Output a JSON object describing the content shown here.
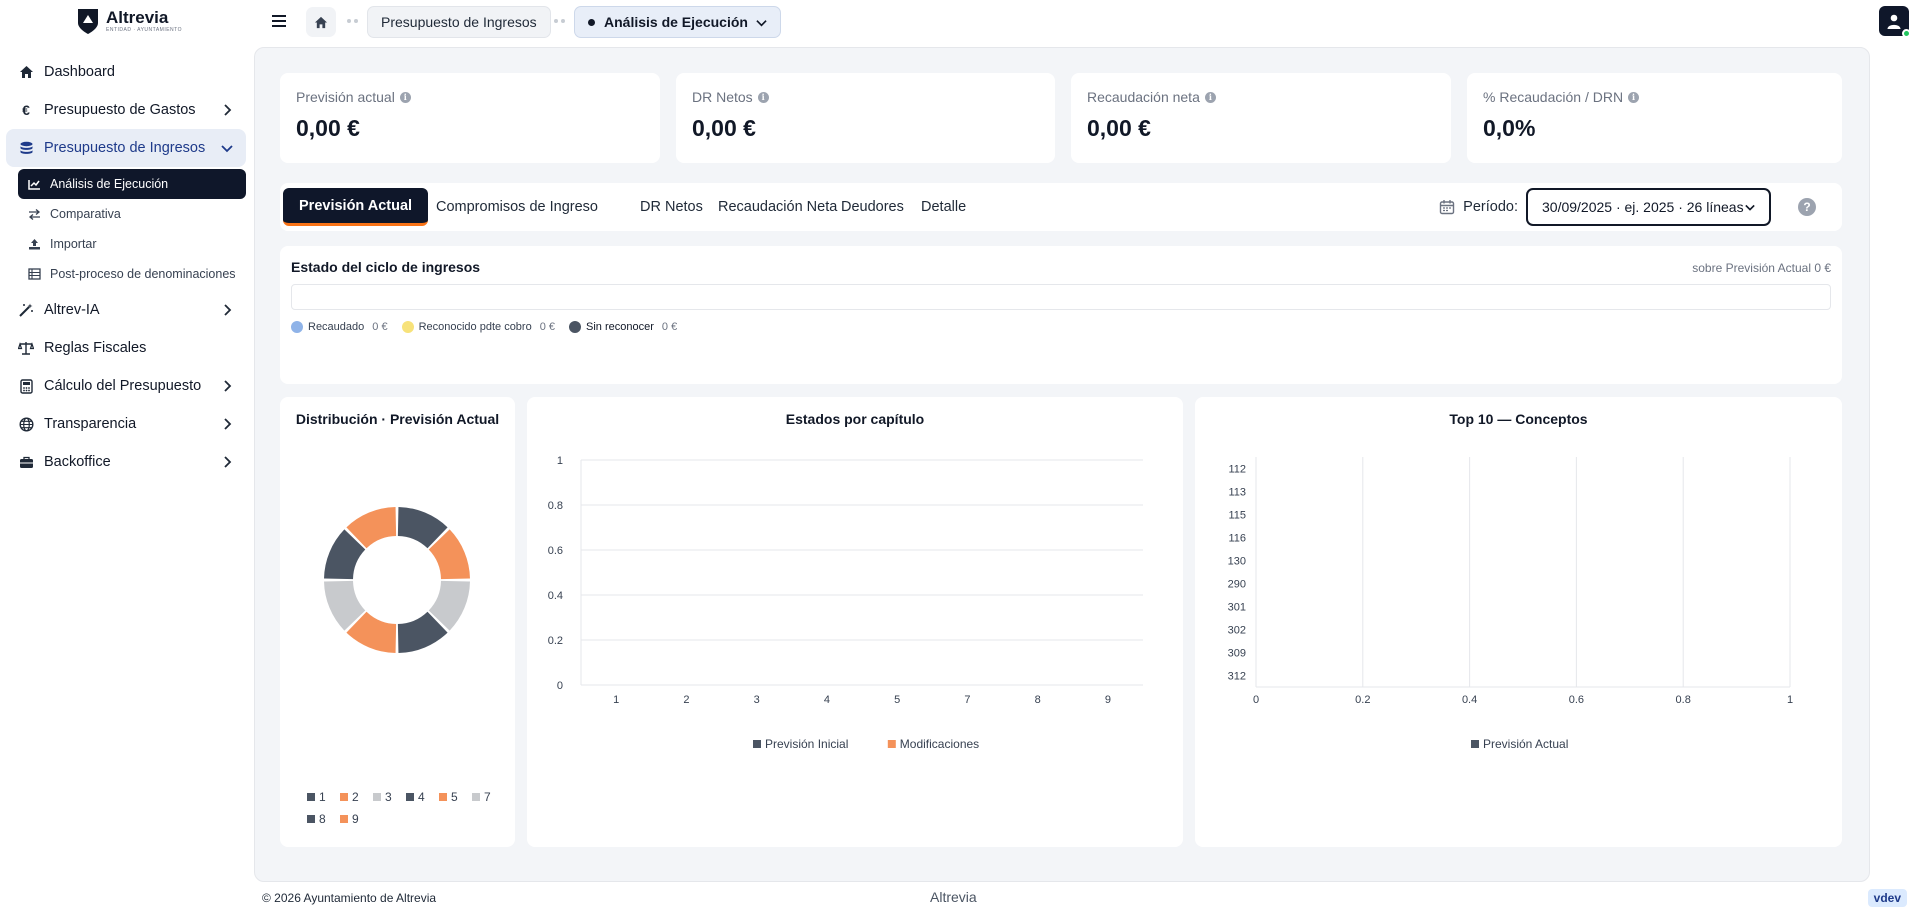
{
  "brand": {
    "name": "Altrevia",
    "subtitle": "ENTIDAD · AYUNTAMIENTO"
  },
  "sidebar": {
    "items": [
      {
        "label": "Dashboard",
        "icon": "home-icon"
      },
      {
        "label": "Presupuesto de Gastos",
        "icon": "euro-icon"
      },
      {
        "label": "Presupuesto de Ingresos",
        "icon": "coins-icon"
      },
      {
        "label": "Altrev-IA",
        "icon": "magic-wand-icon"
      },
      {
        "label": "Reglas Fiscales",
        "icon": "scale-icon"
      },
      {
        "label": "Cálculo del Presupuesto",
        "icon": "calculator-icon"
      },
      {
        "label": "Transparencia",
        "icon": "globe-icon"
      },
      {
        "label": "Backoffice",
        "icon": "briefcase-icon"
      }
    ],
    "subitems": [
      {
        "label": "Análisis de Ejecución",
        "icon": "chart-line-icon"
      },
      {
        "label": "Comparativa",
        "icon": "arrows-exchange-icon"
      },
      {
        "label": "Importar",
        "icon": "upload-icon"
      },
      {
        "label": "Post-proceso de denominaciones",
        "icon": "table-list-icon"
      }
    ]
  },
  "breadcrumb": {
    "section": "Presupuesto de Ingresos",
    "current": "Análisis de Ejecución"
  },
  "kpis": [
    {
      "label": "Previsión actual",
      "value": "0,00 €"
    },
    {
      "label": "DR Netos",
      "value": "0,00 €"
    },
    {
      "label": "Recaudación neta",
      "value": "0,00 €"
    },
    {
      "label": "% Recaudación / DRN",
      "value": "0,0%"
    }
  ],
  "tabs": [
    "Previsión Actual",
    "Compromisos de Ingreso",
    "DR Netos",
    "Recaudación Neta",
    "Deudores",
    "Detalle"
  ],
  "periodo": {
    "label": "Período:",
    "value": "30/09/2025 · ej. 2025 · 26 líneas"
  },
  "ciclo": {
    "title": "Estado del ciclo de ingresos",
    "right": "sobre Previsión Actual 0 €",
    "legend": [
      {
        "label": "Recaudado",
        "value": "0 €",
        "color": "#8fb3e8"
      },
      {
        "label": "Reconocido pdte cobro",
        "value": "0 €",
        "color": "#f7e27a"
      },
      {
        "label": "Sin reconocer",
        "value": "0 €",
        "color": "#4b5563"
      }
    ]
  },
  "chart_data": [
    {
      "type": "pie",
      "title": "Distribución · Previsión Actual",
      "categories": [
        "1",
        "2",
        "3",
        "4",
        "5",
        "7",
        "8",
        "9"
      ],
      "values": [
        1,
        1,
        1,
        1,
        1,
        1,
        1,
        1
      ],
      "colors": [
        "#4b5563",
        "#f4925a",
        "#c8cacd",
        "#4b5563",
        "#f4925a",
        "#c8cacd",
        "#4b5563",
        "#f4925a"
      ],
      "legend": "bottom"
    },
    {
      "type": "bar",
      "title": "Estados por capítulo",
      "categories": [
        "1",
        "2",
        "3",
        "4",
        "5",
        "7",
        "8",
        "9"
      ],
      "series": [
        {
          "name": "Previsión Inicial",
          "values": [
            0,
            0,
            0,
            0,
            0,
            0,
            0,
            0
          ],
          "color": "#4b5563"
        },
        {
          "name": "Modificaciones",
          "values": [
            0,
            0,
            0,
            0,
            0,
            0,
            0,
            0
          ],
          "color": "#f4925a"
        }
      ],
      "yticks": [
        "0",
        "0.2",
        "0.4",
        "0.6",
        "0.8",
        "1"
      ],
      "ylim": [
        0,
        1
      ],
      "grid": true,
      "legend": "bottom"
    },
    {
      "type": "bar",
      "orientation": "horizontal",
      "title": "Top 10 — Conceptos",
      "categories": [
        "112",
        "113",
        "115",
        "116",
        "130",
        "290",
        "301",
        "302",
        "309",
        "312"
      ],
      "series": [
        {
          "name": "Previsión Actual",
          "values": [
            0,
            0,
            0,
            0,
            0,
            0,
            0,
            0,
            0,
            0
          ],
          "color": "#4b5563"
        }
      ],
      "xticks": [
        "0",
        "0.2",
        "0.4",
        "0.6",
        "0.8",
        "1"
      ],
      "xlim": [
        0,
        1
      ],
      "grid": true,
      "legend": "bottom"
    }
  ],
  "footer": {
    "copyright": "© 2026 Ayuntamiento de Altrevia",
    "center": "Altrevia",
    "version": "vdev"
  }
}
